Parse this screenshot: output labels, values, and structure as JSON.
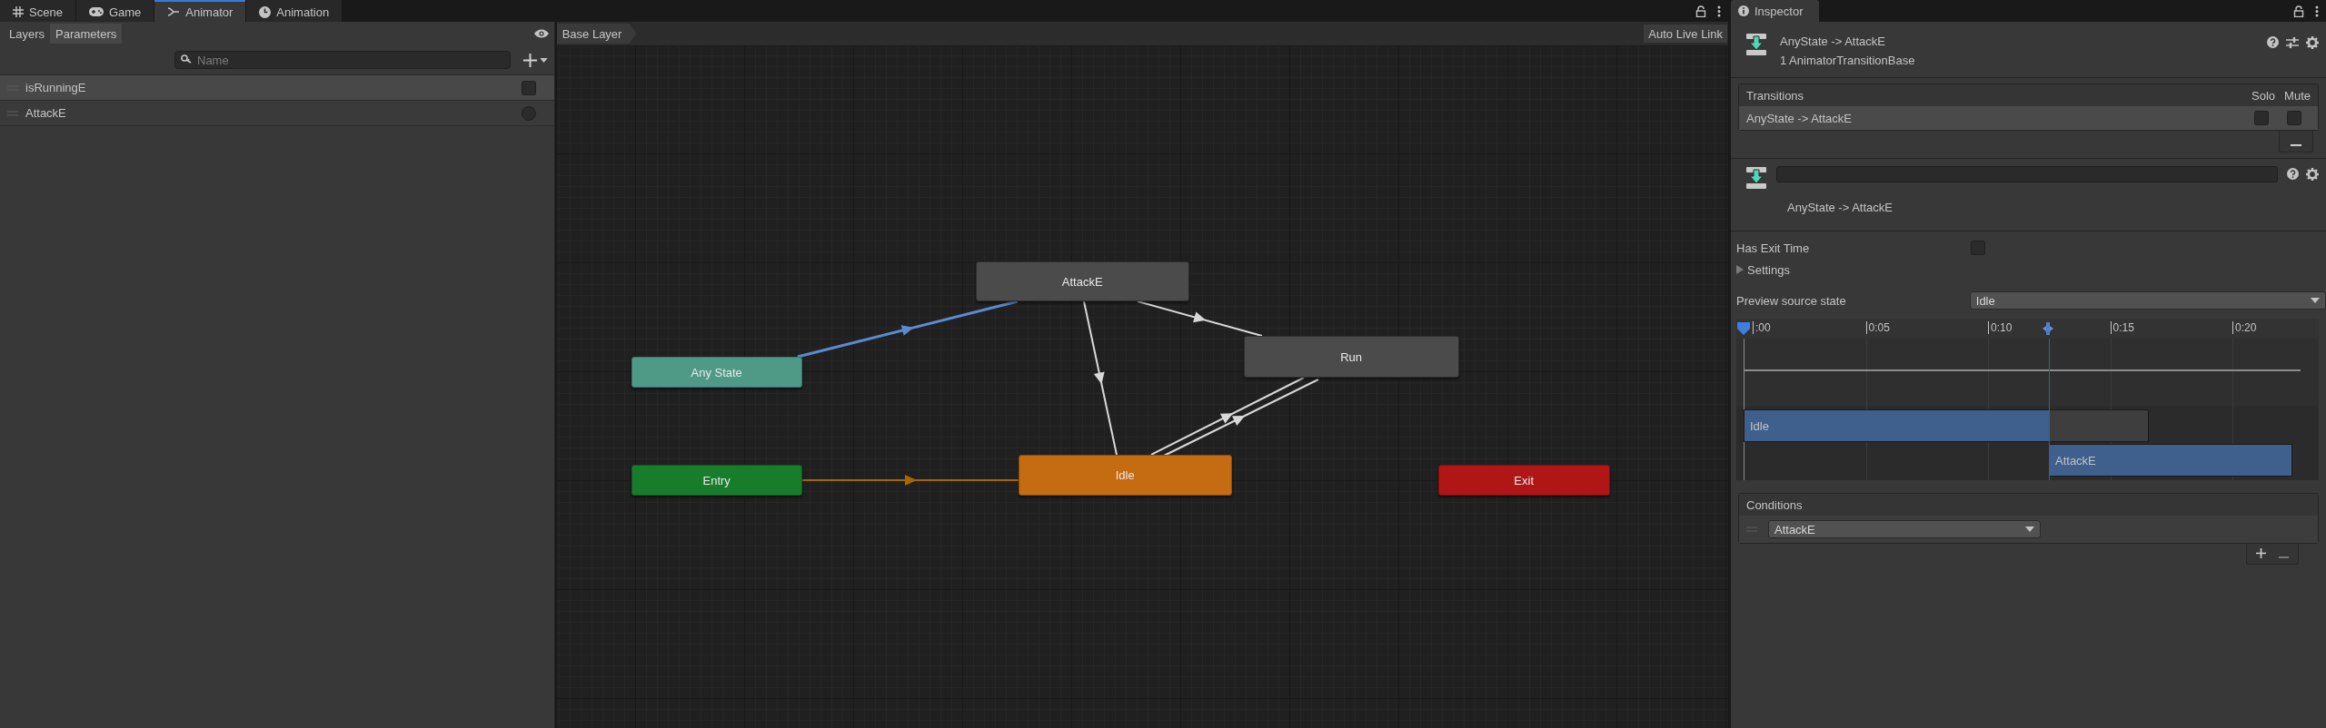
{
  "editor_tabs": [
    {
      "kind": "scene",
      "label": "Scene",
      "selected": false
    },
    {
      "kind": "game",
      "label": "Game",
      "selected": false
    },
    {
      "kind": "animator",
      "label": "Animator",
      "selected": true
    },
    {
      "kind": "animation",
      "label": "Animation",
      "selected": false
    }
  ],
  "animator": {
    "panel_tabs": [
      {
        "label": "Layers",
        "selected": false
      },
      {
        "label": "Parameters",
        "selected": true
      }
    ],
    "search": {
      "placeholder": "Name"
    },
    "parameters": [
      {
        "kind": "bool",
        "name": "isRunningE",
        "selected": true,
        "checked": false
      },
      {
        "kind": "trigger",
        "name": "AttackE",
        "selected": false,
        "checked": false
      }
    ],
    "breadcrumb": "Base Layer",
    "auto_live_link": "Auto Live Link",
    "nodes": [
      {
        "kind": "state",
        "label": "AttackE"
      },
      {
        "kind": "any_state",
        "label": "Any State"
      },
      {
        "kind": "state",
        "label": "Run"
      },
      {
        "kind": "entry",
        "label": "Entry"
      },
      {
        "kind": "default_state",
        "label": "Idle"
      },
      {
        "kind": "exit",
        "label": "Exit"
      }
    ],
    "transitions": [
      {
        "kind": "selected"
      },
      {
        "kind": "default"
      },
      {
        "kind": "normal"
      },
      {
        "kind": "normal"
      },
      {
        "kind": "normal"
      },
      {
        "kind": "normal"
      }
    ]
  },
  "inspector": {
    "tab": "Inspector",
    "title": "AnyState -> AttackE",
    "subtitle": "1 AnimatorTransitionBase",
    "transitions_list": {
      "header": "Transitions",
      "solo_label": "Solo",
      "mute_label": "Mute",
      "rows": [
        {
          "label": "AnyState -> AttackE",
          "selected": true,
          "solo": false,
          "mute": false
        }
      ]
    },
    "transition_label": "AnyState -> AttackE",
    "has_exit_time": {
      "label": "Has Exit Time",
      "checked": false
    },
    "settings": {
      "label": "Settings",
      "expanded": false
    },
    "preview_source_state": {
      "label": "Preview source state",
      "value": "Idle"
    },
    "timeline": {
      "ticks": [
        ":00",
        "0:05",
        "0:10",
        "0:15",
        "0:20"
      ],
      "source_clip": "Idle",
      "target_clip": "AttackE"
    },
    "conditions": {
      "header": "Conditions",
      "rows": [
        {
          "parameter": "AttackE"
        }
      ]
    }
  }
}
